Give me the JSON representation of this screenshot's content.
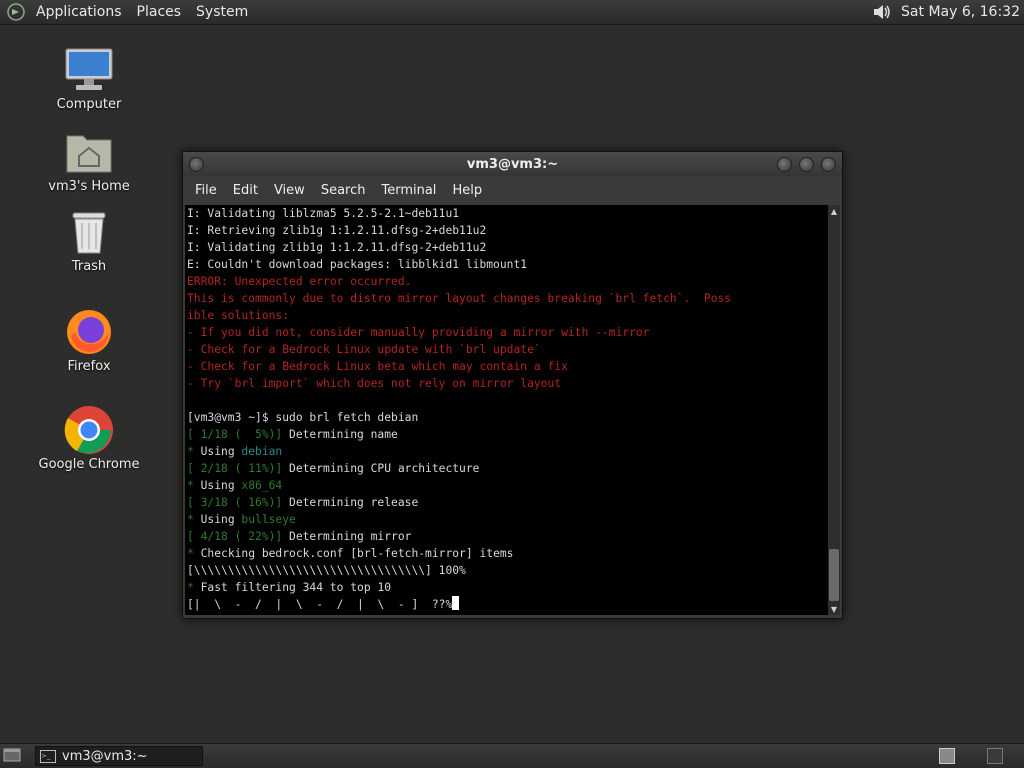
{
  "top_panel": {
    "menus": [
      "Applications",
      "Places",
      "System"
    ],
    "clock": "Sat May  6, 16:32"
  },
  "desktop_icons": [
    {
      "label": "Computer",
      "icon": "computer-icon"
    },
    {
      "label": "vm3's Home",
      "icon": "home-folder-icon"
    },
    {
      "label": "Trash",
      "icon": "trash-icon"
    },
    {
      "label": "Firefox",
      "icon": "firefox-icon"
    },
    {
      "label": "Google Chrome",
      "icon": "chrome-icon"
    }
  ],
  "terminal_window": {
    "title": "vm3@vm3:~",
    "menu": [
      "File",
      "Edit",
      "View",
      "Search",
      "Terminal",
      "Help"
    ],
    "lines": [
      [
        {
          "t": "I: Validating liblzma5 5.2.5-2.1~deb11u1",
          "c": ""
        }
      ],
      [
        {
          "t": "I: Retrieving zlib1g 1:1.2.11.dfsg-2+deb11u2",
          "c": ""
        }
      ],
      [
        {
          "t": "I: Validating zlib1g 1:1.2.11.dfsg-2+deb11u2",
          "c": ""
        }
      ],
      [
        {
          "t": "E: Couldn't download packages: libblkid1 libmount1",
          "c": ""
        }
      ],
      [
        {
          "t": "ERROR: Unexpected error occurred.",
          "c": "red"
        }
      ],
      [
        {
          "t": "This is commonly due to distro mirror layout changes breaking `brl fetch`.  Poss",
          "c": "red"
        }
      ],
      [
        {
          "t": "ible solutions:",
          "c": "red"
        }
      ],
      [
        {
          "t": "- If you did not, consider manually providing a mirror with --mirror",
          "c": "red"
        }
      ],
      [
        {
          "t": "- Check for a Bedrock Linux update with `brl update`",
          "c": "red"
        }
      ],
      [
        {
          "t": "- Check for a Bedrock Linux beta which may contain a fix",
          "c": "red"
        }
      ],
      [
        {
          "t": "- Try `brl import` which does not rely on mirror layout",
          "c": "red"
        }
      ],
      [
        {
          "t": "",
          "c": ""
        }
      ],
      [
        {
          "t": "[vm3@vm3 ~]$ sudo brl fetch debian",
          "c": ""
        }
      ],
      [
        {
          "t": "[ 1/18 (  5%)]",
          "c": "green"
        },
        {
          "t": " Determining name",
          "c": ""
        }
      ],
      [
        {
          "t": "* ",
          "c": "green"
        },
        {
          "t": "Using ",
          "c": ""
        },
        {
          "t": "debian",
          "c": "cyan"
        }
      ],
      [
        {
          "t": "[ 2/18 ( 11%)]",
          "c": "green"
        },
        {
          "t": " Determining CPU architecture",
          "c": ""
        }
      ],
      [
        {
          "t": "* ",
          "c": "green"
        },
        {
          "t": "Using ",
          "c": ""
        },
        {
          "t": "x86_64",
          "c": "green"
        }
      ],
      [
        {
          "t": "[ 3/18 ( 16%)]",
          "c": "green"
        },
        {
          "t": " Determining release",
          "c": ""
        }
      ],
      [
        {
          "t": "* ",
          "c": "green"
        },
        {
          "t": "Using ",
          "c": ""
        },
        {
          "t": "bullseye",
          "c": "green"
        }
      ],
      [
        {
          "t": "[ 4/18 ( 22%)]",
          "c": "green"
        },
        {
          "t": " Determining mirror",
          "c": ""
        }
      ],
      [
        {
          "t": "* ",
          "c": "green"
        },
        {
          "t": "Checking bedrock.conf [brl-fetch-mirror] items",
          "c": ""
        }
      ],
      [
        {
          "t": "[\\\\\\\\\\\\\\\\\\\\\\\\\\\\\\\\\\\\\\\\\\\\\\\\\\\\\\\\\\\\\\\\\\\\] 100%",
          "c": ""
        }
      ],
      [
        {
          "t": "* ",
          "c": "green"
        },
        {
          "t": "Fast filtering 344 to top 10",
          "c": ""
        }
      ],
      [
        {
          "t": "[|  \\  -  /  |  \\  -  /  |  \\  - ]  ??%",
          "c": ""
        }
      ]
    ]
  },
  "bottom_panel": {
    "task_label": "vm3@vm3:~"
  },
  "colors": {
    "desktop_bg": "#2d2d2b",
    "error_red": "#b32424",
    "progress_green": "#2f7a2f",
    "value_cyan": "#2a8a8a"
  }
}
